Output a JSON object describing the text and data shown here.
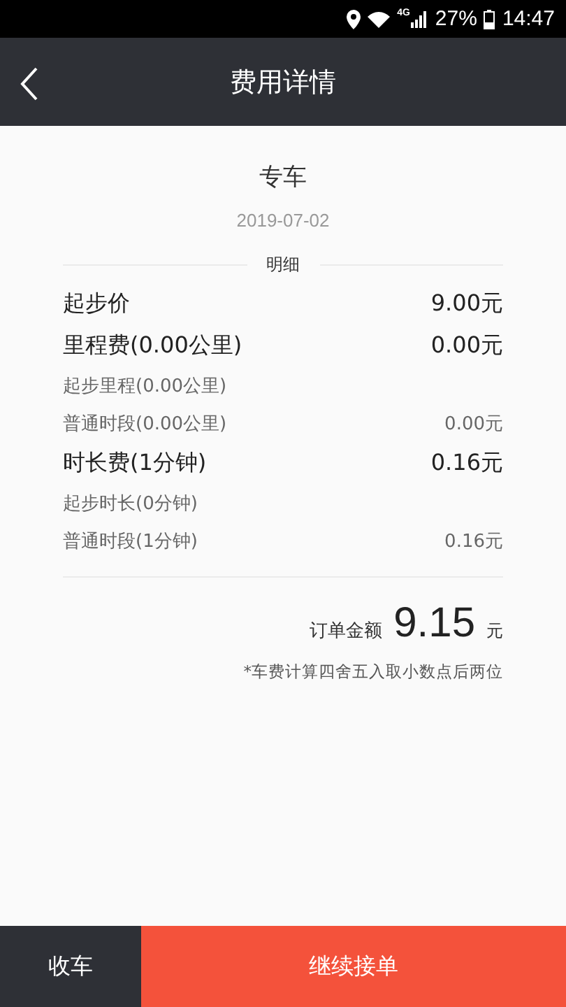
{
  "status_bar": {
    "battery": "27%",
    "time": "14:47",
    "network": "4G"
  },
  "header": {
    "title": "费用详情"
  },
  "summary": {
    "service": "专车",
    "date": "2019-07-02"
  },
  "section_title": "明细",
  "fee_rows": [
    {
      "kind": "main",
      "label": "起步价",
      "amount": "9.00元"
    },
    {
      "kind": "main",
      "label": "里程费(0.00公里)",
      "amount": "0.00元"
    },
    {
      "kind": "sub",
      "label": "起步里程(0.00公里)"
    },
    {
      "kind": "sub",
      "label": "普通时段(0.00公里)",
      "amount": "0.00元"
    },
    {
      "kind": "main",
      "label": "时长费(1分钟)",
      "amount": "0.16元"
    },
    {
      "kind": "sub",
      "label": "起步时长(0分钟)"
    },
    {
      "kind": "sub",
      "label": "普通时段(1分钟)",
      "amount": "0.16元"
    }
  ],
  "total": {
    "label": "订单金额",
    "amount": "9.15",
    "unit": "元"
  },
  "note": "*车费计算四舍五入取小数点后两位",
  "buttons": [
    {
      "kind": "secondary",
      "label": "收车"
    },
    {
      "kind": "primary",
      "label": "继续接单"
    }
  ]
}
